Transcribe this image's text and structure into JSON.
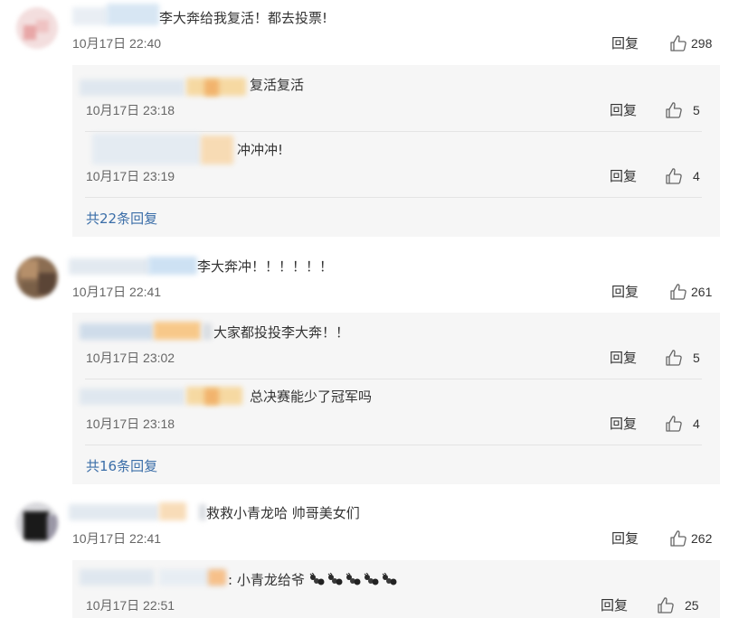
{
  "colors": {
    "accent_link": "#3b6ea8",
    "text": "#333333",
    "meta": "#666666",
    "reply_bg": "#f6f6f6",
    "divider": "#e4e4e4"
  },
  "comments": [
    {
      "text": "李大奔给我复活！都去投票!",
      "time": "10月17日 22:40",
      "reply": "回复",
      "likes": "298",
      "replies": [
        {
          "text": "复活复活",
          "time": "10月17日 23:18",
          "reply": "回复",
          "likes": "5"
        },
        {
          "text": "冲冲冲!",
          "time": "10月17日 23:19",
          "reply": "回复",
          "likes": "4"
        }
      ],
      "more": "共22条回复"
    },
    {
      "text": "李大奔冲！！！！！！",
      "time": "10月17日 22:41",
      "reply": "回复",
      "likes": "261",
      "replies": [
        {
          "text": "大家都投投李大奔！！",
          "time": "10月17日 23:02",
          "reply": "回复",
          "likes": "5"
        },
        {
          "text": "总决赛能少了冠军吗",
          "time": "10月17日 23:18",
          "reply": "回复",
          "likes": "4"
        }
      ],
      "more": "共16条回复"
    },
    {
      "text": "救救小青龙哈 帅哥美女们",
      "time": "10月17日 22:41",
      "reply": "回复",
      "likes": "262",
      "replies": [
        {
          "text": ": 小青龙给爷",
          "emoji": "ant-emoji",
          "time": "10月17日 22:51",
          "reply": "回复",
          "likes": "25"
        }
      ]
    }
  ]
}
